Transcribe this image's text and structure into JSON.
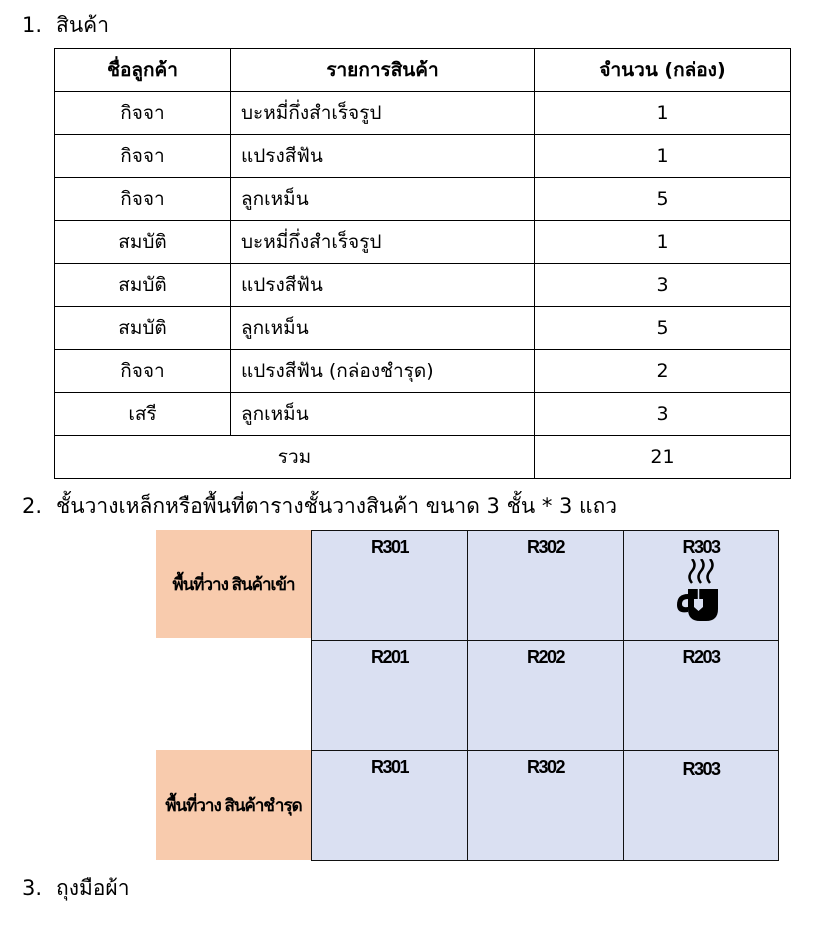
{
  "section1": {
    "number": "1.",
    "title": "สินค้า"
  },
  "table": {
    "headers": [
      "ชื่อลูกค้า",
      "รายการสินค้า",
      "จำนวน (กล่อง)"
    ],
    "rows": [
      [
        "กิจจา",
        "บะหมี่กึ่งสำเร็จรูป",
        "1"
      ],
      [
        "กิจจา",
        "แปรงสีฟัน",
        "1"
      ],
      [
        "กิจจา",
        "ลูกเหม็น",
        "5"
      ],
      [
        "สมบัติ",
        "บะหมี่กึ่งสำเร็จรูป",
        "1"
      ],
      [
        "สมบัติ",
        "แปรงสีฟัน",
        "3"
      ],
      [
        "สมบัติ",
        "ลูกเหม็น",
        "5"
      ],
      [
        "กิจจา",
        "แปรงสีฟัน (กล่องชำรุด)",
        "2"
      ],
      [
        "เสรี",
        "ลูกเหม็น",
        "3"
      ]
    ],
    "total": {
      "label": "รวม",
      "value": "21"
    }
  },
  "section2": {
    "number": "2.",
    "title": "ชั้นวางเหล็กหรือพื้นที่ตารางชั้นวางสินค้า ขนาด 3 ชั้น * 3 แถว"
  },
  "zones": {
    "incoming": "พื้นที่วาง สินค้าเข้า",
    "damaged": "พื้นที่วาง สินค้าชำรุด"
  },
  "shelf": {
    "rows": [
      [
        "R301",
        "R302",
        "R303"
      ],
      [
        "R201",
        "R202",
        "R203"
      ],
      [
        "R301",
        "R302",
        "R303"
      ]
    ],
    "occupied_icon": "coffee-cup-icon",
    "occupied_cell": "R303"
  },
  "section3": {
    "number": "3.",
    "title": "ถุงมือผ้า"
  },
  "colors": {
    "zone_fill": "#f8cbad",
    "shelf_fill": "#dae0f2"
  }
}
